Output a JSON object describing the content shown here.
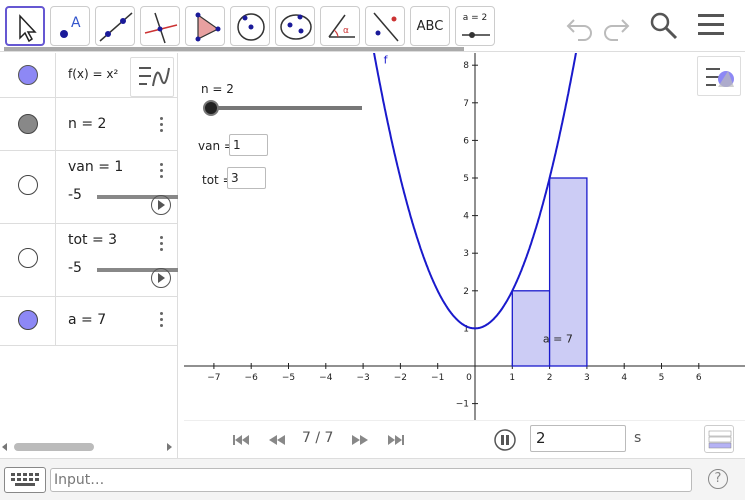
{
  "toolbar": {
    "tools": [
      {
        "name": "move-tool",
        "active": true
      },
      {
        "name": "point-tool"
      },
      {
        "name": "line-tool"
      },
      {
        "name": "perpendicular-line-tool"
      },
      {
        "name": "polygon-tool"
      },
      {
        "name": "circle-tool"
      },
      {
        "name": "ellipse-tool"
      },
      {
        "name": "angle-tool"
      },
      {
        "name": "reflect-tool"
      },
      {
        "name": "text-tool",
        "label": "ABC"
      },
      {
        "name": "slider-tool",
        "label": "a = 2"
      }
    ],
    "right_icons": [
      "undo-icon",
      "redo-icon",
      "search-icon",
      "menu-icon"
    ]
  },
  "algebra": {
    "rows": [
      {
        "name": "f",
        "text": "f(x) = x²",
        "marble_color": "#8d88f5",
        "filled": true
      },
      {
        "name": "n",
        "text": "n = 2",
        "marble_color": "#888888",
        "filled": true
      },
      {
        "name": "van",
        "text": "van = 1",
        "slider_min": "-5",
        "filled": false
      },
      {
        "name": "tot",
        "text": "tot = 3",
        "slider_min": "-5",
        "filled": false
      },
      {
        "name": "a",
        "text": "a = 7",
        "marble_color": "#8d88f5",
        "filled": true
      }
    ]
  },
  "graphics": {
    "slider_n_label": "n = 2",
    "van_label": "van =",
    "van_value": "1",
    "tot_label": "tot =",
    "tot_value": "3",
    "function_label": "f",
    "area_label": "a = 7",
    "x_ticks": [
      "−7",
      "−6",
      "−5",
      "−4",
      "−3",
      "−2",
      "−1",
      "0",
      "1",
      "2",
      "3",
      "4",
      "5",
      "6"
    ],
    "y_ticks": [
      "8",
      "7",
      "6",
      "5",
      "4",
      "3",
      "2",
      "1",
      "−1"
    ]
  },
  "animation": {
    "step_text": "7 / 7",
    "speed_value": "2",
    "speed_unit": "s"
  },
  "input_bar": {
    "placeholder": "Input…",
    "help": "?"
  },
  "colors": {
    "accent": "#6557d2",
    "curve": "#1a1acc",
    "bar_fill": "#ccccf5",
    "bar_stroke": "#1a1acc"
  }
}
